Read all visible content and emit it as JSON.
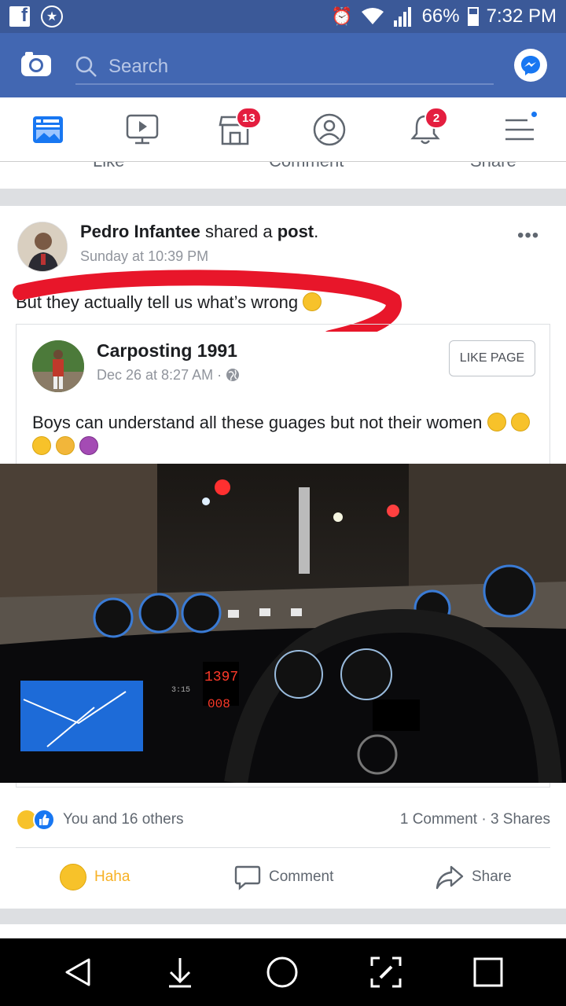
{
  "status_bar": {
    "battery": "66%",
    "time": "7:32 PM",
    "battery_level": 0.66
  },
  "app_bar": {
    "search_placeholder": "Search"
  },
  "nav_tabs": {
    "marketplace_badge": "13",
    "notifications_badge": "2"
  },
  "prev_post_actions": [
    "Like",
    "Comment",
    "Share"
  ],
  "post": {
    "author": "Pedro Infantee",
    "action_text": "shared a",
    "object_text": "post",
    "timestamp": "Sunday at 10:39 PM",
    "text": "But they actually tell us what’s wrong",
    "shared": {
      "page_name": "Carposting 1991",
      "timestamp": "Dec 26 at 8:27 AM",
      "like_page_label": "LIKE PAGE",
      "text": "Boys can understand all these guages but not their women"
    },
    "photo": {
      "readout_top": "1397",
      "readout_bottom": "008",
      "clock": "3:15"
    },
    "reactions_text": "You and 16 others",
    "comments_text": "1 Comment",
    "shares_text": "3 Shares",
    "actions": {
      "haha": "Haha",
      "comment": "Comment",
      "share": "Share"
    }
  },
  "colors": {
    "brand": "#4267b2",
    "status_bar": "#3b5998",
    "badge": "#e41e3f",
    "scribble": "#e8162a",
    "haha": "#f7b125"
  }
}
